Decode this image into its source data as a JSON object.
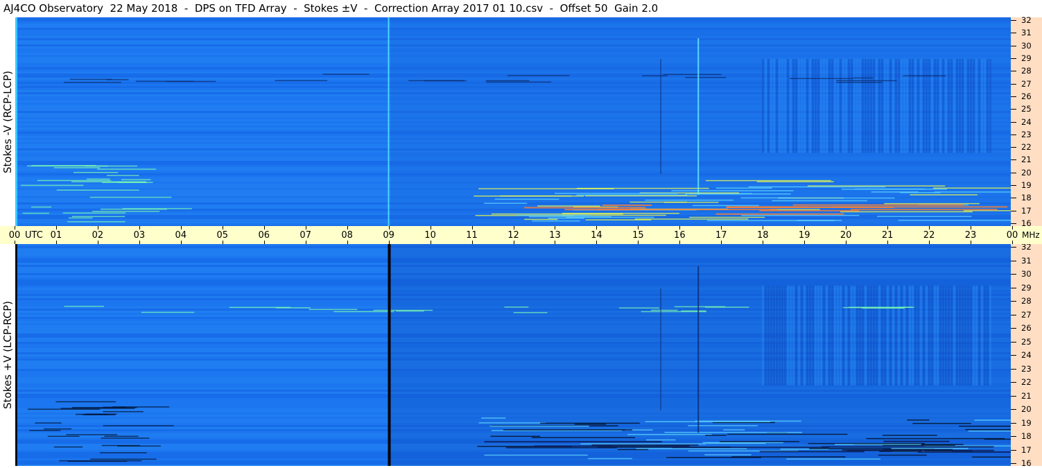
{
  "title": "AJ4CO Observatory  22 May 2018  -  DPS on TFD Array  -  Stokes ±V  -  Correction Array 2017 01 10.csv  -  Offset 50  Gain 2.0",
  "panels": [
    {
      "ylabel": "Stokes -V (RCP-LCP)"
    },
    {
      "ylabel": "Stokes +V (LCP-RCP)"
    }
  ],
  "time_axis": {
    "utc_label": "UTC",
    "unit_label": "MHz",
    "ticks": [
      "00",
      "01",
      "02",
      "03",
      "04",
      "05",
      "06",
      "07",
      "08",
      "09",
      "10",
      "11",
      "12",
      "13",
      "14",
      "15",
      "16",
      "17",
      "18",
      "19",
      "20",
      "21",
      "22",
      "23",
      "00"
    ]
  },
  "colors": {
    "background_blue": "#1a74ee",
    "time_axis_bg": "#ffffcc",
    "freq_axis_bg": "#ffdec3"
  },
  "chart_data": [
    {
      "type": "heatmap",
      "title": "AJ4CO Observatory  22 May 2018  -  DPS on TFD Array  -  Stokes ±V  -  Correction Array 2017 01 10.csv  -  Offset 50  Gain 2.0",
      "ylabel": "Stokes -V (RCP-LCP)",
      "xlabel": "UTC",
      "x_ticks": [
        "00",
        "01",
        "02",
        "03",
        "04",
        "05",
        "06",
        "07",
        "08",
        "09",
        "10",
        "11",
        "12",
        "13",
        "14",
        "15",
        "16",
        "17",
        "18",
        "19",
        "20",
        "21",
        "22",
        "23",
        "00"
      ],
      "xlim_hours_utc": [
        0,
        24
      ],
      "y_unit": "MHz",
      "y_ticks": [
        16,
        17,
        18,
        19,
        20,
        21,
        22,
        23,
        24,
        25,
        26,
        27,
        28,
        29,
        30,
        31,
        32
      ],
      "ylim": [
        16,
        32
      ]
    },
    {
      "type": "heatmap",
      "ylabel": "Stokes +V (LCP-RCP)",
      "xlabel": "UTC",
      "x_ticks": [
        "00",
        "01",
        "02",
        "03",
        "04",
        "05",
        "06",
        "07",
        "08",
        "09",
        "10",
        "11",
        "12",
        "13",
        "14",
        "15",
        "16",
        "17",
        "18",
        "19",
        "20",
        "21",
        "22",
        "23",
        "00"
      ],
      "xlim_hours_utc": [
        0,
        24
      ],
      "y_unit": "MHz",
      "y_ticks": [
        16,
        17,
        18,
        19,
        20,
        21,
        22,
        23,
        24,
        25,
        26,
        27,
        28,
        29,
        30,
        31,
        32
      ],
      "ylim": [
        16,
        32
      ]
    }
  ]
}
